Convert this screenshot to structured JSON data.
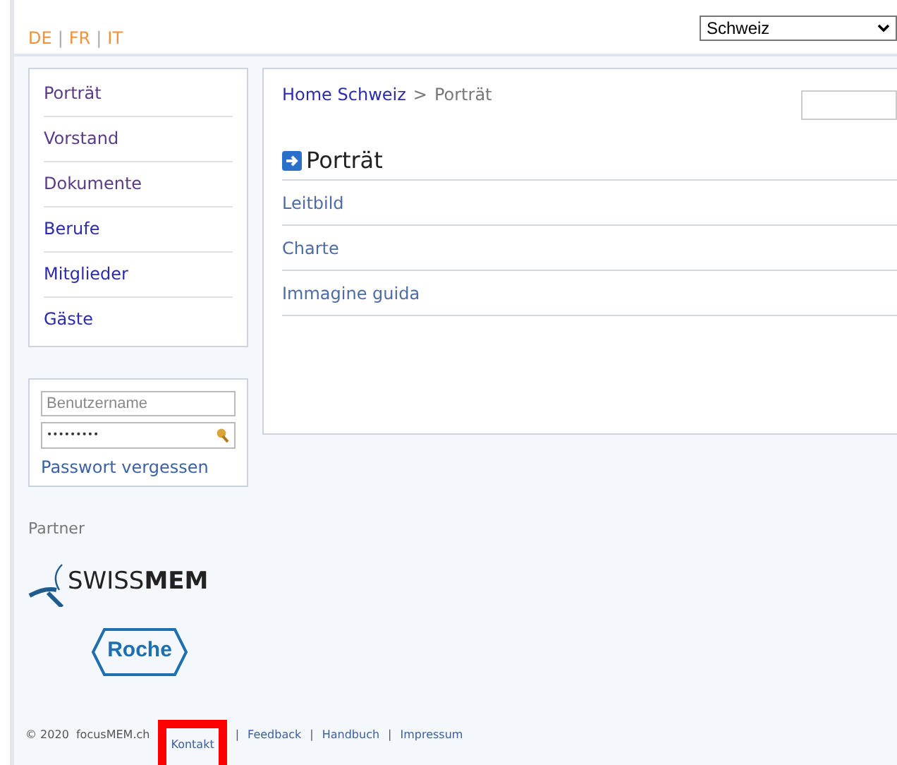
{
  "languages": [
    {
      "kind": "link",
      "text": "DE"
    },
    {
      "kind": "separator",
      "text": "|"
    },
    {
      "kind": "link",
      "text": "FR"
    },
    {
      "kind": "separator",
      "text": "|"
    },
    {
      "kind": "link",
      "text": "IT"
    }
  ],
  "country_select": {
    "value": "Schweiz"
  },
  "sidebar": {
    "items": [
      {
        "label": "Porträt",
        "visited": true
      },
      {
        "label": "Vorstand",
        "visited": true
      },
      {
        "label": "Dokumente",
        "visited": true
      },
      {
        "label": "Berufe",
        "visited": false
      },
      {
        "label": "Mitglieder",
        "visited": false
      },
      {
        "label": "Gäste",
        "visited": false
      }
    ]
  },
  "login": {
    "username_placeholder": "Benutzername",
    "password_value": "•••••••••",
    "forgot_link": "Passwort vergessen"
  },
  "partners": {
    "title": "Partner",
    "logos": [
      {
        "kind": "swissmem",
        "text": "SWISS**MEM**"
      },
      {
        "kind": "roche",
        "text": "Roche"
      }
    ]
  },
  "breadcrumb": {
    "home": "Home Schweiz",
    "separator": ">",
    "current": "Porträt"
  },
  "heading": "Porträt",
  "links": [
    "Leitbild",
    "Charte",
    "Immagine guida"
  ],
  "footer": [
    {
      "kind": "text",
      "text": "© 2020  focusMEM.ch"
    },
    {
      "kind": "link",
      "text": "Kontakt",
      "highlighted": true
    },
    {
      "kind": "separator",
      "text": "|"
    },
    {
      "kind": "link",
      "text": "Feedback",
      "highlighted": false
    },
    {
      "kind": "separator",
      "text": "|"
    },
    {
      "kind": "link",
      "text": "Handbuch",
      "highlighted": false
    },
    {
      "kind": "separator",
      "text": "|"
    },
    {
      "kind": "link",
      "text": "Impressum",
      "highlighted": false
    }
  ]
}
